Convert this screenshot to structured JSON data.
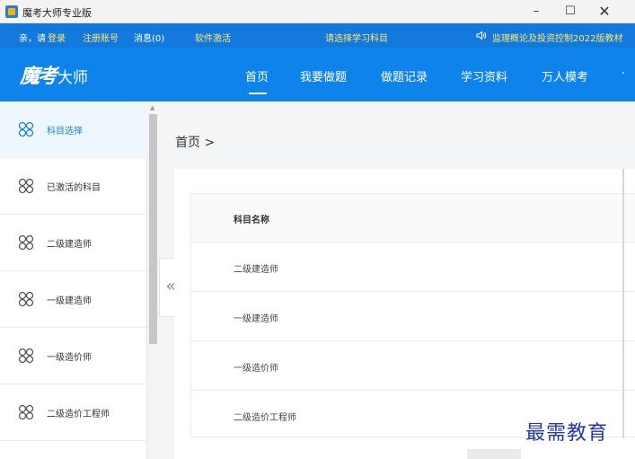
{
  "window": {
    "title": "魔考大师专业版",
    "minimize_glyph": "–",
    "maximize_glyph": "☐",
    "close_glyph": "✕"
  },
  "infobar": {
    "greeting": "亲，请",
    "login": "登录",
    "register": "注册账号",
    "messages": "消息(0)",
    "activate": "软件激活",
    "select_subject": "请选择学习科目",
    "speaker_icon": "speaker-icon",
    "notice": "监理概论及投资控制2022版教材"
  },
  "navbar": {
    "logo_calligraphy": "魔考",
    "logo_text": "大师",
    "tabs": [
      "首页",
      "我要做题",
      "做题记录",
      "学习资料",
      "万人模考",
      "·"
    ],
    "active_tab": "首页"
  },
  "sidebar": {
    "items": [
      {
        "label": "科目选择",
        "active": true
      },
      {
        "label": "已激活的科目",
        "active": false
      },
      {
        "label": "二级建造师",
        "active": false
      },
      {
        "label": "一级建造师",
        "active": false
      },
      {
        "label": "一级造价师",
        "active": false
      },
      {
        "label": "二级造价工程师",
        "active": false
      }
    ],
    "icon": "clover-icon",
    "collapse_glyph": "«"
  },
  "main": {
    "breadcrumb": "首页 >",
    "table": {
      "header": "科目名称",
      "rows": [
        "二级建造师",
        "一级建造师",
        "一级造价师",
        "二级造价工程师"
      ]
    }
  },
  "watermark": "最需教育",
  "colors": {
    "infobar_bg": "#1479dd",
    "navbar_bg": "#0e83ec",
    "highlight_text": "#ffe76a",
    "sidebar_active_text": "#1f7fd9",
    "watermark": "#2438a8"
  }
}
